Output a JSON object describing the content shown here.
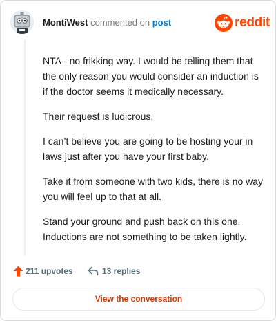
{
  "comment": {
    "author": "MontiWest",
    "action_text": "commented on",
    "link_text": "post",
    "paragraphs": [
      "NTA - no frikking way. I would be telling them that the only reason you would consider an induction is if the doctor seems it medically necessary.",
      "Their request is ludicrous.",
      "I can’t believe you are going to be hosting your in laws just after you have your first baby.",
      "Take it from someone with two kids, there is no way you will feel up to that at all.",
      "Stand your ground and push back on this one. Inductions are not something to be taken lightly."
    ]
  },
  "brand": {
    "name": "reddit",
    "icon": "reddit-snoo-icon",
    "color": "#ff4500"
  },
  "actions": {
    "upvotes_label": "211 upvotes",
    "replies_label": "13 replies",
    "upvote_icon": "upvote-arrow-icon",
    "reply_icon": "reply-arrow-icon",
    "upvote_color": "#ff4500"
  },
  "footer": {
    "button_label": "View the conversation"
  }
}
